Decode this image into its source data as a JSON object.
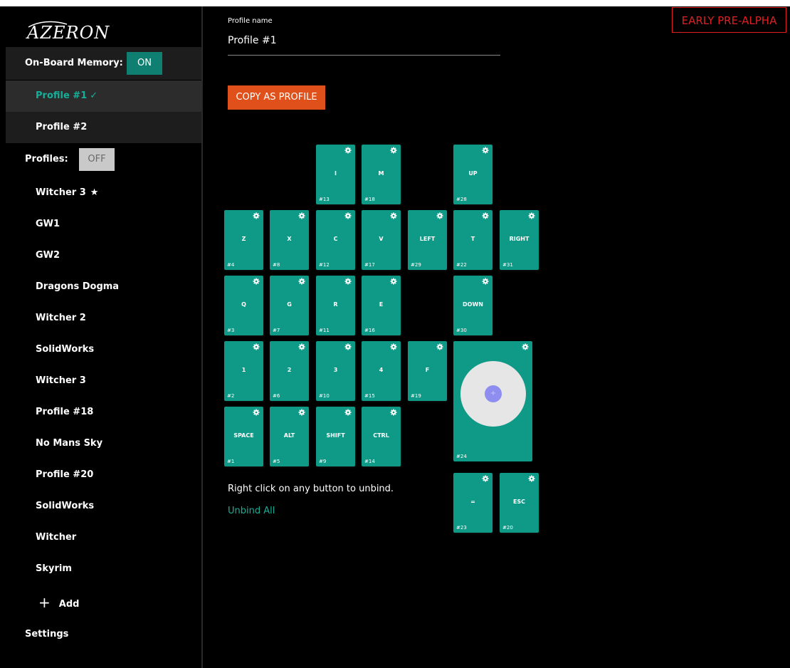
{
  "app": {
    "name": "AZERON"
  },
  "sidebar": {
    "onboard_memory": {
      "label": "On-Board Memory:",
      "toggle": "ON"
    },
    "onboard_profiles": [
      {
        "label": "Profile #1",
        "active": true,
        "check": "✓"
      },
      {
        "label": "Profile #2",
        "active": false
      }
    ],
    "profiles_section": {
      "label": "Profiles:",
      "toggle": "OFF"
    },
    "profiles": [
      {
        "label": "Witcher 3",
        "star": "★"
      },
      {
        "label": "GW1"
      },
      {
        "label": "GW2"
      },
      {
        "label": "Dragons Dogma"
      },
      {
        "label": "Witcher 2"
      },
      {
        "label": "SolidWorks"
      },
      {
        "label": "Witcher 3"
      },
      {
        "label": "Profile #18"
      },
      {
        "label": "No Mans Sky"
      },
      {
        "label": "Profile #20"
      },
      {
        "label": "SolidWorks"
      },
      {
        "label": "Witcher"
      },
      {
        "label": "Skyrim"
      }
    ],
    "add_label": "Add",
    "settings_label": "Settings"
  },
  "main": {
    "profile_name_label": "Profile name",
    "profile_name_value": "Profile #1",
    "copy_button": "COPY AS PROFILE",
    "badge": "EARLY PRE-ALPHA",
    "hint": "Right click on any button to unbind.",
    "unbind_all": "Unbind All"
  },
  "keys": [
    {
      "label": "I",
      "num": "#13"
    },
    {
      "label": "M",
      "num": "#18"
    },
    {
      "label": "UP",
      "num": "#28"
    },
    {
      "label": "Z",
      "num": "#4"
    },
    {
      "label": "X",
      "num": "#8"
    },
    {
      "label": "C",
      "num": "#12"
    },
    {
      "label": "V",
      "num": "#17"
    },
    {
      "label": "LEFT",
      "num": "#29"
    },
    {
      "label": "T",
      "num": "#22"
    },
    {
      "label": "RIGHT",
      "num": "#31"
    },
    {
      "label": "Q",
      "num": "#3"
    },
    {
      "label": "G",
      "num": "#7"
    },
    {
      "label": "R",
      "num": "#11"
    },
    {
      "label": "E",
      "num": "#16"
    },
    {
      "label": "DOWN",
      "num": "#30"
    },
    {
      "label": "1",
      "num": "#2"
    },
    {
      "label": "2",
      "num": "#6"
    },
    {
      "label": "3",
      "num": "#10"
    },
    {
      "label": "4",
      "num": "#15"
    },
    {
      "label": "F",
      "num": "#19"
    },
    {
      "label": "SPACE",
      "num": "#1"
    },
    {
      "label": "ALT",
      "num": "#5"
    },
    {
      "label": "SHIFT",
      "num": "#9"
    },
    {
      "label": "CTRL",
      "num": "#14"
    },
    {
      "label": "=",
      "num": "#23"
    },
    {
      "label": "ESC",
      "num": "#20"
    }
  ],
  "thumbstick": {
    "num": "#24",
    "center_glyph": "+"
  },
  "colors": {
    "accent": "#0f9a87",
    "primary_text_active": "#14b09a",
    "copy_button": "#e0501a",
    "alpha_badge": "#e02020"
  }
}
